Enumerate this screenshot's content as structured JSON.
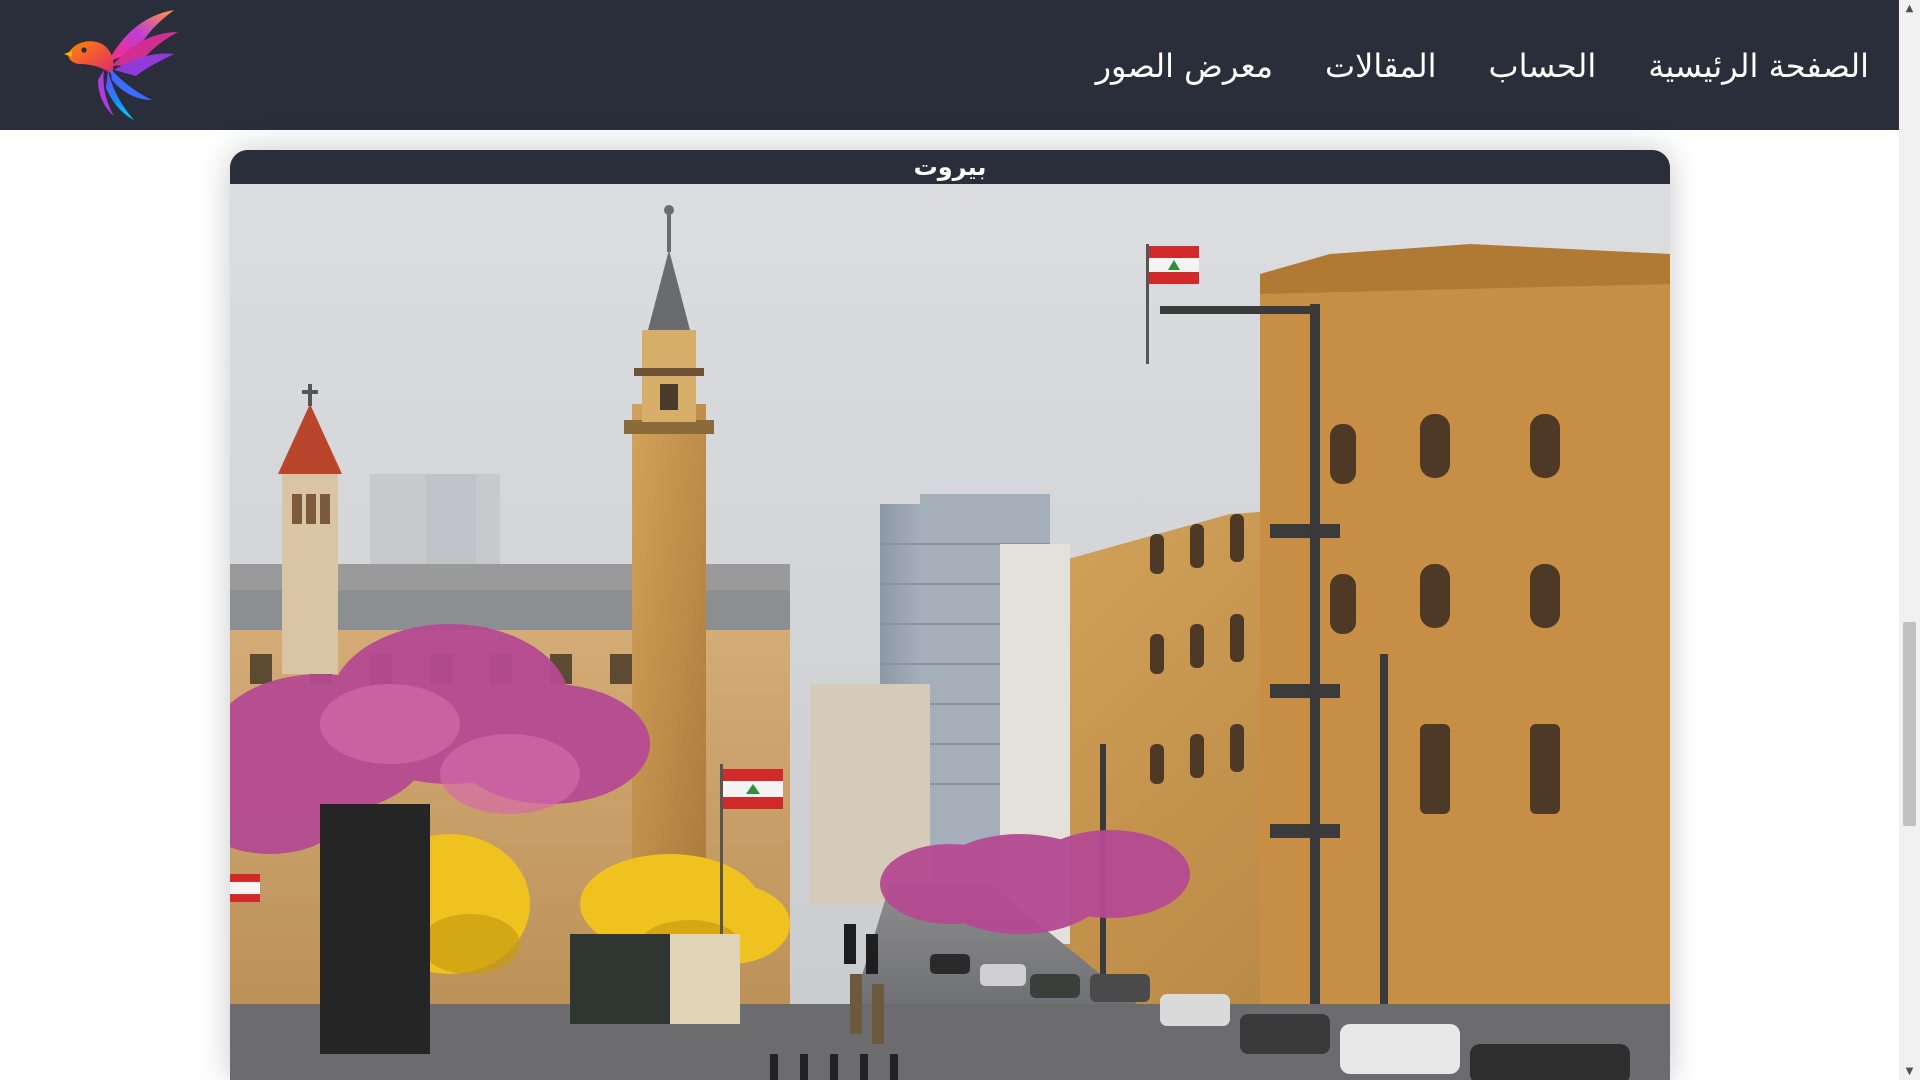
{
  "nav": {
    "items": [
      {
        "label": "الصفحة الرئيسية"
      },
      {
        "label": "الحساب"
      },
      {
        "label": "المقالات"
      },
      {
        "label": "معرض الصور"
      }
    ]
  },
  "logo": {
    "icon": "phoenix-bird-logo-icon"
  },
  "gallery": {
    "card": {
      "title": "بيروت",
      "photo_icon": "beirut-street-photo"
    }
  },
  "colors": {
    "navbar_bg": "#2a2e3a",
    "nav_text": "#ffffff",
    "page_bg": "#ffffff"
  },
  "scrollbar": {
    "up_icon": "scroll-up-arrow-icon",
    "down_icon": "scroll-down-arrow-icon"
  }
}
